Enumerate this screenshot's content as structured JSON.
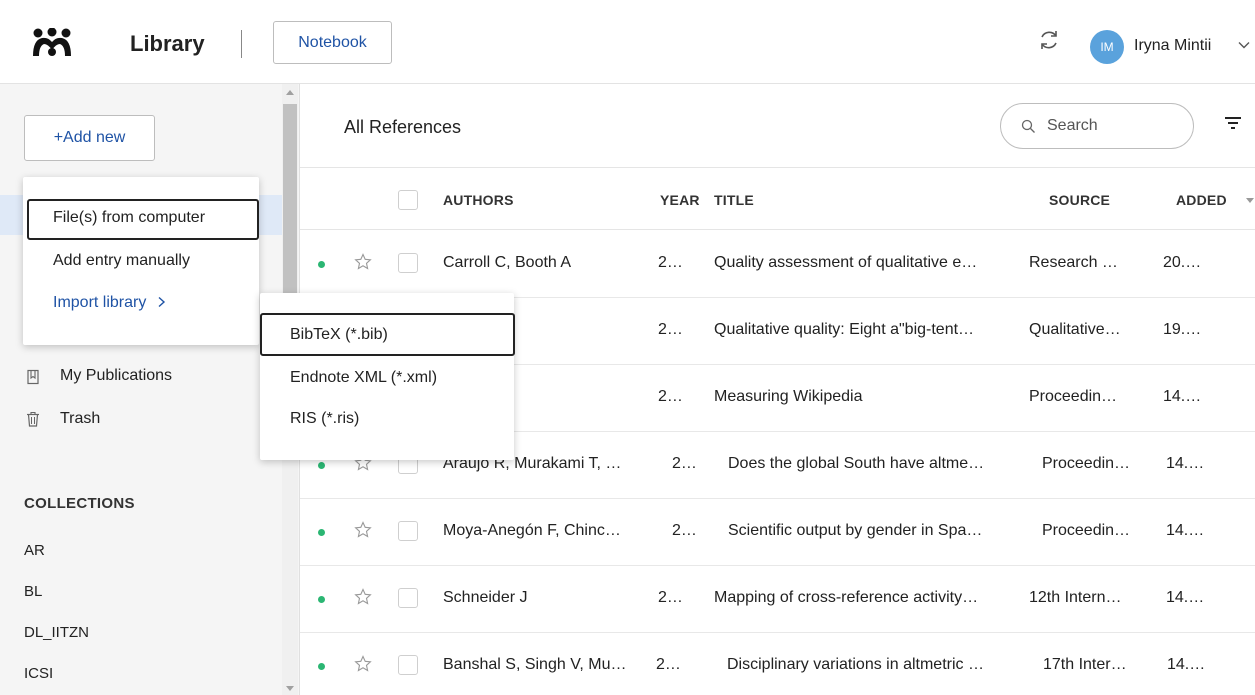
{
  "header": {
    "app_title": "Library",
    "notebook_label": "Notebook",
    "user_initials": "IM",
    "user_name": "Iryna Mintii"
  },
  "sidebar": {
    "add_new_label": "+Add new",
    "items": [
      {
        "label": "My Publications",
        "icon": "document-icon"
      },
      {
        "label": "Trash",
        "icon": "trash-icon"
      }
    ],
    "collections_header": "COLLECTIONS",
    "collections": [
      "AR",
      "BL",
      "DL_IITZN",
      "ICSI"
    ]
  },
  "add_menu": {
    "items": [
      "File(s) from computer",
      "Add entry manually"
    ],
    "import_label": "Import library"
  },
  "import_menu": {
    "items": [
      "BibTeX (*.bib)",
      "Endnote XML (*.xml)",
      "RIS (*.ris)"
    ]
  },
  "main": {
    "title": "All References",
    "search_placeholder": "Search",
    "columns": {
      "authors": "AUTHORS",
      "year": "YEAR",
      "title": "TITLE",
      "source": "SOURCE",
      "added": "ADDED"
    },
    "rows": [
      {
        "authors": "Carroll C, Booth A",
        "year": "2…",
        "title": "Quality assessment of qualitative e…",
        "source": "Research …",
        "added": "20.…"
      },
      {
        "authors": "",
        "year": "2…",
        "title": "Qualitative quality: Eight a\"big-tent…",
        "source": "Qualitative…",
        "added": "19.…"
      },
      {
        "authors": "",
        "year": "2…",
        "title": "Measuring Wikipedia",
        "source": "Proceedin…",
        "added": "14.…"
      },
      {
        "authors": "Araujo R, Murakami T, …",
        "year": "2…",
        "title": "Does the global South have altme…",
        "source": "Proceedin…",
        "added": "14.…"
      },
      {
        "authors": "Moya-Anegón F, Chinc…",
        "year": "2…",
        "title": "Scientific output by gender in Spa…",
        "source": "Proceedin…",
        "added": "14.…"
      },
      {
        "authors": "Schneider J",
        "year": "2…",
        "title": "Mapping of cross-reference activity…",
        "source": "12th Intern…",
        "added": "14.…"
      },
      {
        "authors": "Banshal S, Singh V, Mu…",
        "year": "2…",
        "title": "Disciplinary variations in altmetric …",
        "source": "17th Inter…",
        "added": "14.…"
      }
    ]
  },
  "colors": {
    "accent": "#1f53a5",
    "avatar": "#5aa2dc",
    "read_dot": "#2bb673"
  }
}
